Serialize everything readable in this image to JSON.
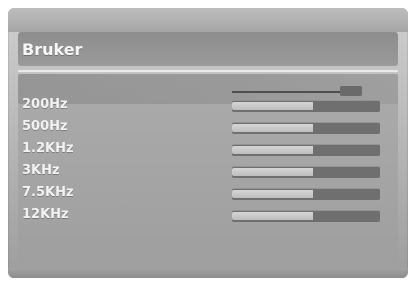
{
  "menu": {
    "title": "Bruker",
    "items": [
      {
        "label": "200Hz",
        "level": 0.55
      },
      {
        "label": "500Hz",
        "level": 0.55
      },
      {
        "label": "1.2KHz",
        "level": 0.55
      },
      {
        "label": "3KHz",
        "level": 0.55
      },
      {
        "label": "7.5KHz",
        "level": 0.55
      },
      {
        "label": "12KHz",
        "level": 0.55
      }
    ],
    "master_level": 0.9
  }
}
